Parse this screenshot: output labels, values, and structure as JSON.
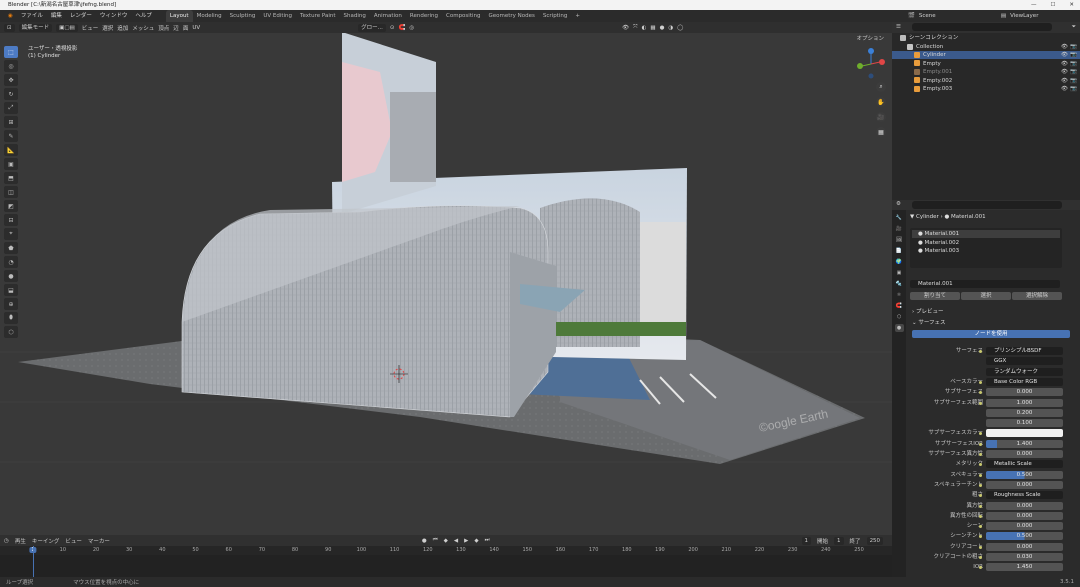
{
  "window": {
    "title": "Blender [C:\\新潟名古屋草津\\jfefng.blend]",
    "controls": [
      "—",
      "☐",
      "✕"
    ]
  },
  "menubar": {
    "menus": [
      "ファイル",
      "編集",
      "レンダー",
      "ウィンドウ",
      "ヘルプ"
    ],
    "workspaces": [
      "Layout",
      "Modeling",
      "Sculpting",
      "UV Editing",
      "Texture Paint",
      "Shading",
      "Animation",
      "Rendering",
      "Compositing",
      "Geometry Nodes",
      "Scripting",
      "+"
    ],
    "active_workspace": "Layout",
    "scene": "Scene",
    "view_layer": "ViewLayer"
  },
  "viewport": {
    "mode": "編集モード",
    "menus": [
      "ビュー",
      "選択",
      "追加",
      "メッシュ",
      "頂点",
      "辺",
      "面",
      "UV"
    ],
    "transform_orientation": "グロー...",
    "options": "オプション",
    "view_name": "ユーザー・透視投影",
    "object_name": "(1) Cylinder"
  },
  "tools": [
    {
      "name": "select-tool",
      "glyph": "⬚",
      "active": true
    },
    {
      "name": "cursor-tool",
      "glyph": "◎"
    },
    {
      "name": "move-tool",
      "glyph": "✥"
    },
    {
      "name": "rotate-tool",
      "glyph": "↻"
    },
    {
      "name": "scale-tool",
      "glyph": "⤢"
    },
    {
      "name": "transform-tool",
      "glyph": "⊞"
    },
    {
      "name": "annotate-tool",
      "glyph": "✎"
    },
    {
      "name": "measure-tool",
      "glyph": "📐"
    },
    {
      "name": "add-cube-tool",
      "glyph": "▣"
    },
    {
      "name": "extrude-tool",
      "glyph": "⬒"
    },
    {
      "name": "inset-tool",
      "glyph": "◫"
    },
    {
      "name": "bevel-tool",
      "glyph": "◩"
    },
    {
      "name": "loopcut-tool",
      "glyph": "⊟"
    },
    {
      "name": "knife-tool",
      "glyph": "⌖"
    },
    {
      "name": "polybuild-tool",
      "glyph": "⬟"
    },
    {
      "name": "spin-tool",
      "glyph": "◔"
    },
    {
      "name": "smooth-tool",
      "glyph": "●"
    },
    {
      "name": "edge-slide-tool",
      "glyph": "⬓"
    },
    {
      "name": "shrink-tool",
      "glyph": "⊕"
    },
    {
      "name": "shear-tool",
      "glyph": "⬮"
    },
    {
      "name": "rip-tool",
      "glyph": "⬡"
    }
  ],
  "timeline": {
    "menus": [
      "再生",
      "キーイング",
      "ビュー",
      "マーカー"
    ],
    "current_frame": "1",
    "start_label": "開始",
    "start": "1",
    "end_label": "終了",
    "end": "250",
    "ticks": [
      "1",
      "10",
      "20",
      "30",
      "40",
      "50",
      "60",
      "70",
      "80",
      "90",
      "100",
      "110",
      "120",
      "130",
      "140",
      "150",
      "160",
      "170",
      "180",
      "190",
      "200",
      "210",
      "220",
      "230",
      "240",
      "250"
    ]
  },
  "statusbar": {
    "left": "ループ選択",
    "middle": "マウス位置を視点の中心に",
    "version": "3.5.1"
  },
  "outliner": {
    "title": "シーンコレクション",
    "rows": [
      {
        "label": "Collection",
        "indent": 1,
        "color": "#c4c4c4",
        "selected": false
      },
      {
        "label": "Cylinder",
        "indent": 2,
        "color": "#e89c3c",
        "selected": true
      },
      {
        "label": "Empty",
        "indent": 2,
        "color": "#e89c3c",
        "selected": false
      },
      {
        "label": "Empty.001",
        "indent": 2,
        "color": "#8a6a4a",
        "selected": false
      },
      {
        "label": "Empty.002",
        "indent": 2,
        "color": "#e89c3c",
        "selected": false
      },
      {
        "label": "Empty.003",
        "indent": 2,
        "color": "#e89c3c",
        "selected": false
      }
    ]
  },
  "properties": {
    "breadcrumb_object": "Cylinder",
    "breadcrumb_material": "Material.001",
    "slots": [
      "Material.001",
      "Material.002",
      "Material.003"
    ],
    "material_name": "Material.001",
    "assign_buttons": [
      "割り当て",
      "選択",
      "選択解除"
    ],
    "preview_label": "プレビュー",
    "surface_label": "サーフェス",
    "use_nodes_label": "ノードを使用",
    "rows": [
      {
        "label": "サーフェス",
        "value": "プリンシプルBSDF",
        "kind": "dark"
      },
      {
        "label": "",
        "value": "GGX",
        "kind": "dark"
      },
      {
        "label": "",
        "value": "ランダムウォーク",
        "kind": "dark"
      },
      {
        "label": "ベースカラー",
        "value": "Base Color RGB",
        "kind": "dark"
      },
      {
        "label": "サブサーフェス",
        "value": "0.000",
        "kind": "num"
      },
      {
        "label": "サブサーフェス範囲",
        "value": "1.000",
        "kind": "num"
      },
      {
        "label": "",
        "value": "0.200",
        "kind": "num"
      },
      {
        "label": "",
        "value": "0.100",
        "kind": "num"
      },
      {
        "label": "サブサーフェスカラー",
        "value": "",
        "kind": "white"
      },
      {
        "label": "サブサーフェスIOR",
        "value": "1.400",
        "kind": "bar",
        "fill": 0.14
      },
      {
        "label": "サブサーフェス異方性",
        "value": "0.000",
        "kind": "num"
      },
      {
        "label": "メタリック",
        "value": "Metallic Scale",
        "kind": "dark"
      },
      {
        "label": "スペキュラー",
        "value": "0.500",
        "kind": "bar",
        "fill": 0.5
      },
      {
        "label": "スペキュラーチント",
        "value": "0.000",
        "kind": "num"
      },
      {
        "label": "粗さ",
        "value": "Roughness Scale",
        "kind": "dark"
      },
      {
        "label": "異方性",
        "value": "0.000",
        "kind": "num"
      },
      {
        "label": "異方性の回転",
        "value": "0.000",
        "kind": "num"
      },
      {
        "label": "シーン",
        "value": "0.000",
        "kind": "num"
      },
      {
        "label": "シーンチント",
        "value": "0.500",
        "kind": "bar",
        "fill": 0.5
      },
      {
        "label": "クリアコート",
        "value": "0.000",
        "kind": "num"
      },
      {
        "label": "クリアコートの粗さ",
        "value": "0.030",
        "kind": "num"
      },
      {
        "label": "IOR",
        "value": "1.450",
        "kind": "num"
      }
    ]
  },
  "colors": {
    "accent": "#4772b3",
    "selected_outline": "#e89c3c"
  }
}
